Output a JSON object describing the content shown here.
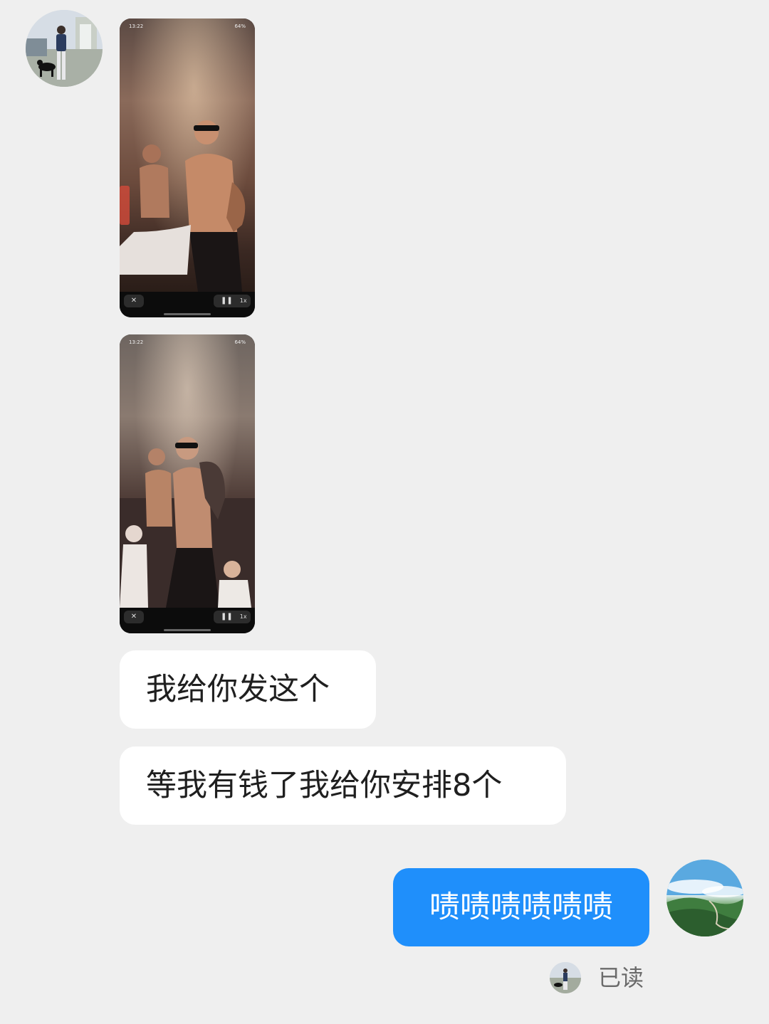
{
  "chat": {
    "media": [
      {
        "status_time": "13:22",
        "status_right": "64%",
        "close_icon": "close-icon",
        "pause_icon": "pause-icon",
        "speed_label": "1x"
      },
      {
        "status_time": "13:22",
        "status_right": "64%",
        "close_icon": "close-icon",
        "pause_icon": "pause-icon",
        "speed_label": "1x"
      }
    ],
    "incoming_messages": [
      "我给你发这个",
      "等我有钱了我给你安排8个"
    ],
    "outgoing_message": "啧啧啧啧啧啧",
    "read_receipt": "已读"
  },
  "colors": {
    "background": "#efefef",
    "incoming_bubble": "#ffffff",
    "outgoing_bubble": "#1f8ffb",
    "read_text": "#6a6a6a"
  }
}
